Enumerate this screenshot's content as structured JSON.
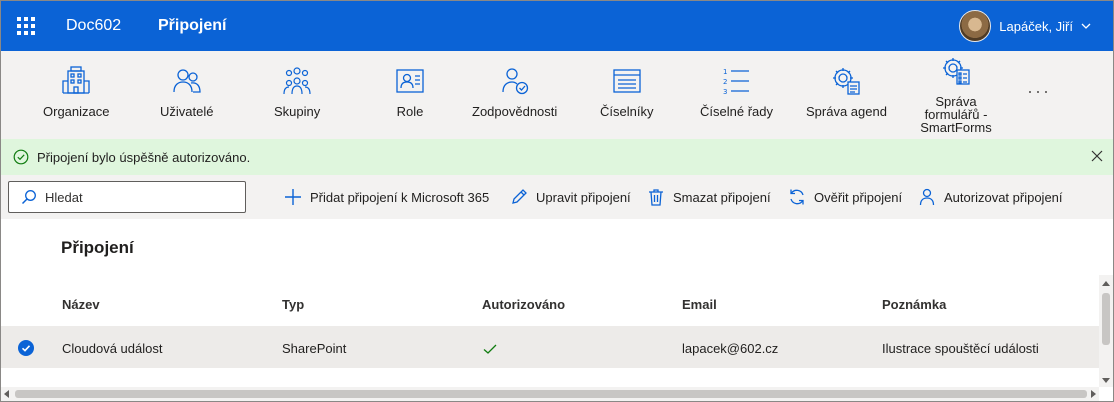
{
  "header": {
    "app_name": "Doc602",
    "page_name": "Připojení",
    "user_name": "Lapáček, Jiří"
  },
  "ribbon": {
    "items": [
      {
        "label": "Organizace",
        "icon": "building-icon"
      },
      {
        "label": "Uživatelé",
        "icon": "users-icon"
      },
      {
        "label": "Skupiny",
        "icon": "group-icon"
      },
      {
        "label": "Role",
        "icon": "id-card-icon"
      },
      {
        "label": "Zodpovědnosti",
        "icon": "person-check-icon"
      },
      {
        "label": "Číselníky",
        "icon": "list-window-icon"
      },
      {
        "label": "Číselné řady",
        "icon": "numbered-list-icon"
      },
      {
        "label": "Správa agend",
        "icon": "gear-document-icon"
      },
      {
        "label": "Správa formulářů - SmartForms",
        "icon": "gear-form-icon"
      }
    ],
    "more": "···"
  },
  "message": {
    "text": "Připojení bylo úspěšně autorizováno.",
    "type": "success"
  },
  "toolbar": {
    "search_placeholder": "Hledat",
    "add_label": "Přidat připojení k Microsoft 365",
    "edit_label": "Upravit připojení",
    "delete_label": "Smazat připojení",
    "verify_label": "Ověřit připojení",
    "authorize_label": "Autorizovat připojení"
  },
  "content": {
    "title": "Připojení",
    "columns": [
      "Název",
      "Typ",
      "Autorizováno",
      "Email",
      "Poznámka"
    ],
    "rows": [
      {
        "name": "Cloudová událost",
        "type": "SharePoint",
        "authorized": true,
        "email": "lapacek@602.cz",
        "note": "Ilustrace spouštěcí události",
        "selected": true
      }
    ]
  },
  "colors": {
    "header_bg": "#0b63d6",
    "accent": "#0b63d6",
    "success_bg": "#dff6dd",
    "success_icon": "#107c10"
  }
}
